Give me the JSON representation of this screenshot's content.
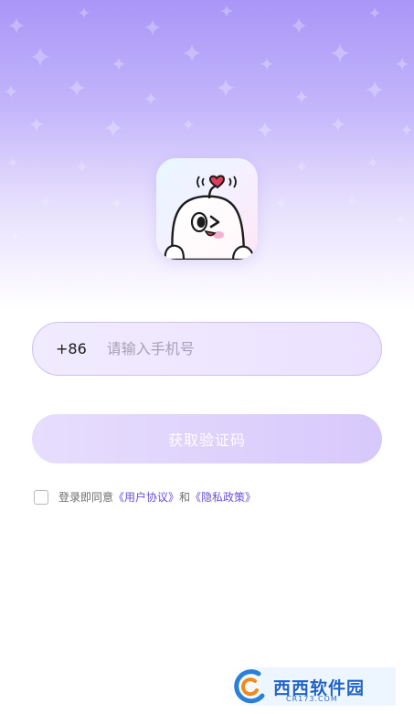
{
  "login": {
    "country_code": "+86",
    "phone_placeholder": "请输入手机号",
    "get_code_label": "获取验证码"
  },
  "agreement": {
    "checked": false,
    "prefix": "登录即同意",
    "user_agreement": "《用户协议》",
    "conjunction": "和",
    "privacy_policy": "《隐私政策》"
  },
  "watermark": {
    "text": "西西软件园",
    "sub": "CR173.COM"
  },
  "colors": {
    "accent": "#6a4fd6",
    "hero_top": "#a996f7",
    "button_disabled": "#d7c8fb"
  },
  "icons": {
    "logo": "app-mascot-logo",
    "checkbox": "checkbox-unchecked"
  }
}
